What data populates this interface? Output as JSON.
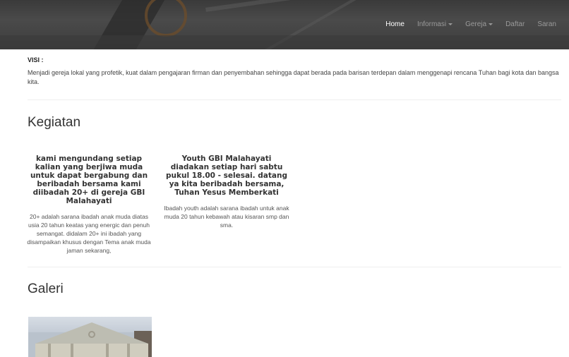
{
  "nav": {
    "items": [
      {
        "label": "Home",
        "active": true,
        "dropdown": false
      },
      {
        "label": "Informasi",
        "active": false,
        "dropdown": true
      },
      {
        "label": "Gereja",
        "active": false,
        "dropdown": true
      },
      {
        "label": "Daftar",
        "active": false,
        "dropdown": false
      },
      {
        "label": "Saran",
        "active": false,
        "dropdown": false
      }
    ]
  },
  "visi": {
    "label": "VISI :",
    "text": "Menjadi gereja lokal yang profetik, kuat dalam pengajaran firman dan penyembahan sehingga dapat berada pada barisan terdepan dalam menggenapi rencana Tuhan bagi kota dan bangsa kita."
  },
  "kegiatan": {
    "title": "Kegiatan",
    "cards": [
      {
        "heading": "kami mengundang setiap kalian yang berjiwa muda untuk dapat bergabung dan beribadah bersama kami diibadah 20+ di gereja GBI Malahayati",
        "body": "20+ adalah sarana ibadah anak muda diatas usia 20 tahun keatas yang energic dan penuh semangat. didalam 20+ ini ibadah yang disampaikan khusus dengan Tema anak muda jaman sekarang,"
      },
      {
        "heading": "Youth GBI Malahayati diadakan setiap hari sabtu pukul 18.00 - selesai. datang ya kita beribadah bersama, Tuhan Yesus Memberkati",
        "body": "Ibadah youth adalah sarana ibadah untuk anak muda 20 tahun kebawah atau kisaran smp dan sma."
      }
    ]
  },
  "galeri": {
    "title": "Galeri"
  },
  "colors": {
    "nav_active": "#ffffff",
    "nav_inactive": "#9a9a9a",
    "header_bg": "#3d3d3d"
  }
}
